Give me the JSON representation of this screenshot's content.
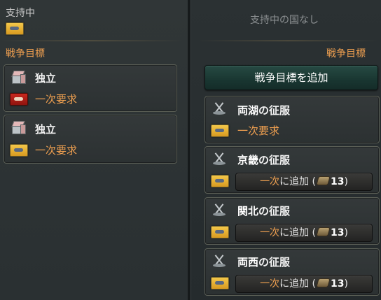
{
  "left": {
    "supporting_label": "支持中",
    "war_goals_label": "戦争目標",
    "goals": [
      {
        "title": "独立",
        "demand": "一次要求",
        "flag": "red"
      },
      {
        "title": "独立",
        "demand": "一次要求",
        "flag": "gold"
      }
    ]
  },
  "right": {
    "no_supported_label": "支持中の国なし",
    "war_goals_label": "戦争目標",
    "add_war_goal_button": "戦争目標を追加",
    "goals": [
      {
        "region": "両湖",
        "suffix": "の征服",
        "demand": "一次要求",
        "button": null
      },
      {
        "region": "京畿",
        "suffix": "の征服",
        "button": {
          "prefix": "一次",
          "middle": "に追加 (",
          "cost": "13",
          "suffix": ")"
        }
      },
      {
        "region": "関北",
        "suffix": "の征服",
        "button": {
          "prefix": "一次",
          "middle": "に追加 (",
          "cost": "13",
          "suffix": ")"
        }
      },
      {
        "region": "両西",
        "suffix": "の征服",
        "button": {
          "prefix": "一次",
          "middle": "に追加 (",
          "cost": "13",
          "suffix": ")"
        }
      }
    ]
  },
  "colors": {
    "accent_orange": "#f0a050",
    "button_green": "#1f3f39",
    "gold_flag": "#e9b33a",
    "red_flag": "#b8241b"
  },
  "icons": {
    "independence": "crate-icon",
    "conquest": "crossed-swords-icon",
    "cost": "gold-ingot-icon"
  }
}
